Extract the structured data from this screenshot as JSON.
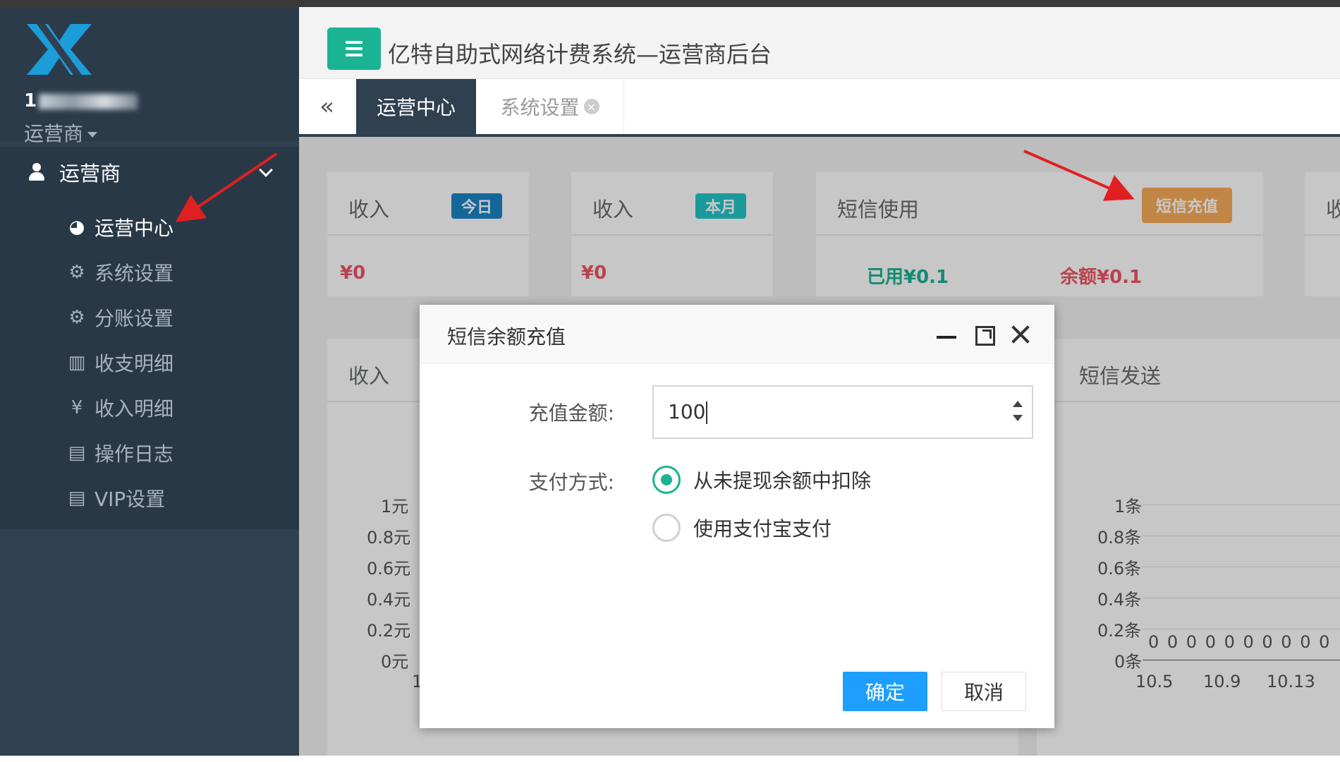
{
  "app": {
    "title": "亿特自助式网络计费系统—运营商后台"
  },
  "user": {
    "id_visible": "1",
    "role": "运营商"
  },
  "sidebar": {
    "group_label": "运营商",
    "items": [
      {
        "label": "运营中心",
        "icon": "dashboard-icon"
      },
      {
        "label": "系统设置",
        "icon": "gears-icon"
      },
      {
        "label": "分账设置",
        "icon": "gears-icon"
      },
      {
        "label": "收支明细",
        "icon": "bar-chart-icon"
      },
      {
        "label": "收入明细",
        "icon": "yen-icon"
      },
      {
        "label": "操作日志",
        "icon": "document-icon"
      },
      {
        "label": "VIP设置",
        "icon": "document-icon"
      }
    ]
  },
  "tabs": [
    {
      "label": "运营中心",
      "active": true
    },
    {
      "label": "系统设置",
      "active": false
    }
  ],
  "stats": {
    "income_today": {
      "title": "收入",
      "badge": "今日",
      "value": "¥0"
    },
    "income_month": {
      "title": "收入",
      "badge": "本月",
      "value": "¥0"
    },
    "sms": {
      "title": "短信使用",
      "badge": "短信充值",
      "used": "已用¥0.1",
      "balance": "余额¥0.1"
    },
    "partial_title": "收"
  },
  "charts": {
    "income_title": "收入",
    "income_yticks": [
      "1元",
      "0.8元",
      "0.6元",
      "0.4元",
      "0.2元",
      "0元"
    ],
    "income_xtick_first": "1",
    "sms_title": "短信发送",
    "sms_yticks": [
      "1条",
      "0.8条",
      "0.6条",
      "0.4条",
      "0.2条",
      "0条"
    ],
    "sms_xticks": [
      "10.5",
      "10.9",
      "10.13"
    ],
    "sms_zero_labels": "0 0 0 0 0 0 0 0 0 0"
  },
  "dialog": {
    "title": "短信余额充值",
    "amount_label": "充值金额:",
    "amount_value": "100",
    "pay_label": "支付方式:",
    "options": [
      {
        "label": "从未提现余额中扣除",
        "checked": true
      },
      {
        "label": "使用支付宝支付",
        "checked": false
      }
    ],
    "ok_label": "确定",
    "cancel_label": "取消"
  },
  "colors": {
    "sidebar_bg": "#2f4050",
    "accent_green": "#1ab394",
    "badge_blue": "#1c84c6",
    "badge_orange": "#f8ac59",
    "money_red": "#ed5565",
    "ok_blue": "#1e9fff"
  }
}
